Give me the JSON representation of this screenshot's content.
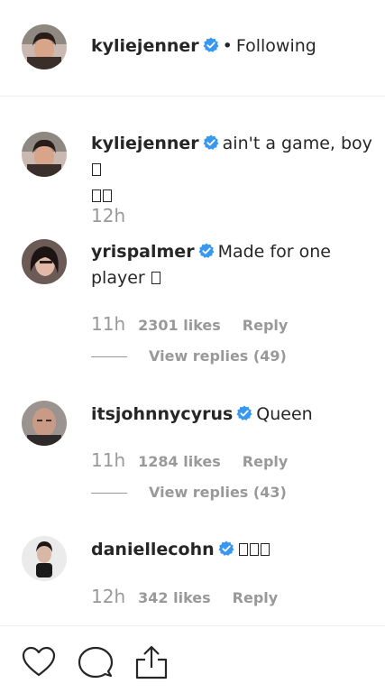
{
  "header": {
    "username": "kyliejenner",
    "separator": "•",
    "follow_status": "Following"
  },
  "comments": [
    {
      "username": "kyliejenner",
      "text": "ain't a game, boy",
      "time": "12h"
    },
    {
      "username": "yrispalmer",
      "text": "Made for one player",
      "time": "11h",
      "likes": "2301 likes",
      "reply": "Reply",
      "view_replies": "View replies (49)"
    },
    {
      "username": "itsjohnnycyrus",
      "text": "Queen",
      "time": "11h",
      "likes": "1284 likes",
      "reply": "Reply",
      "view_replies": "View replies (43)"
    },
    {
      "username": "daniellecohn",
      "text": "",
      "time": "12h",
      "likes": "342 likes",
      "reply": "Reply"
    }
  ],
  "actions": {
    "like_icon": "heart-icon",
    "comment_icon": "comment-icon",
    "share_icon": "share-icon"
  },
  "colors": {
    "verified": "#3897f0",
    "muted": "#999999",
    "text": "#262626"
  }
}
